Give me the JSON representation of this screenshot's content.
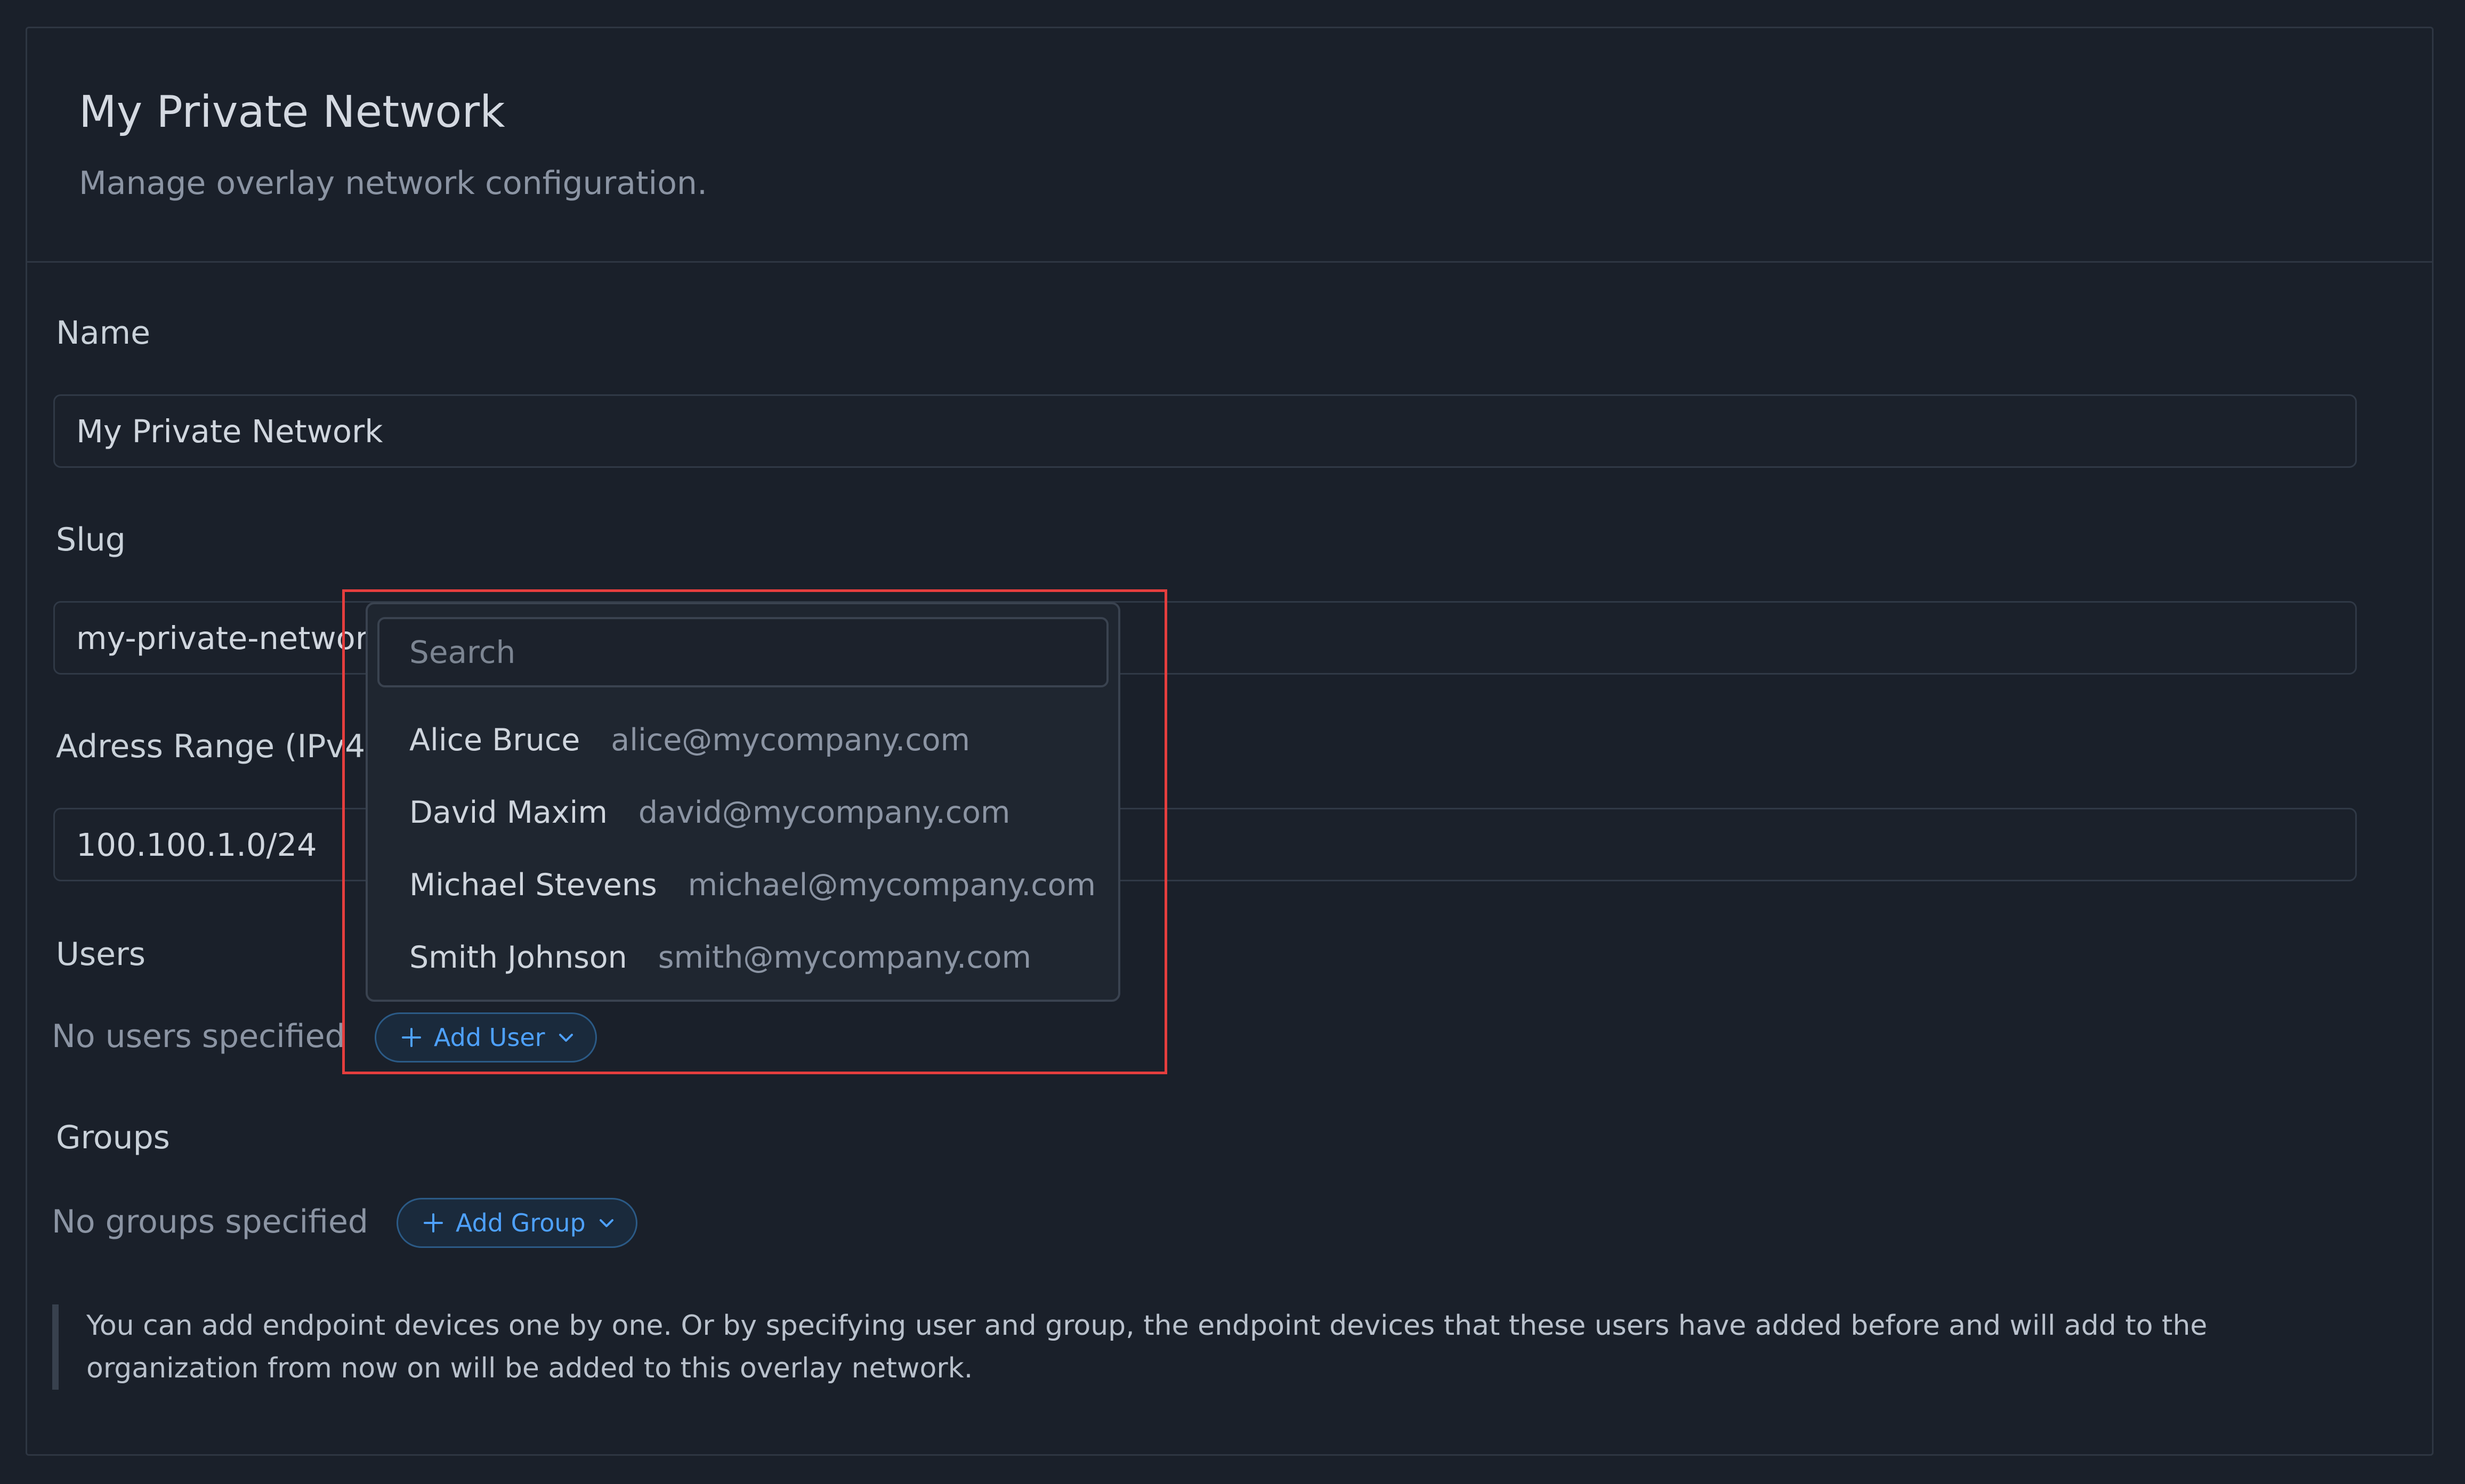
{
  "page": {
    "title": "My Private Network",
    "subtitle": "Manage overlay network configuration."
  },
  "form": {
    "name_label": "Name",
    "name_value": "My Private Network",
    "slug_label": "Slug",
    "slug_value": "my-private-network",
    "range_label": "Adress Range (IPv4)",
    "range_value": "100.100.1.0/24",
    "users_label": "Users",
    "users_empty": "No users specified",
    "add_user_label": "Add User",
    "groups_label": "Groups",
    "groups_empty": "No groups specified",
    "add_group_label": "Add Group",
    "note": "You can add endpoint devices one by one. Or by specifying user and group, the endpoint devices that these users have added before and will add to the organization from now on will be added to this overlay network."
  },
  "dropdown": {
    "search_placeholder": "Search",
    "items": [
      {
        "name": "Alice Bruce",
        "email": "alice@mycompany.com"
      },
      {
        "name": "David Maxim",
        "email": "david@mycompany.com"
      },
      {
        "name": "Michael Stevens",
        "email": "michael@mycompany.com"
      },
      {
        "name": "Smith Johnson",
        "email": "smith@mycompany.com"
      }
    ]
  },
  "colors": {
    "background": "#1a202a",
    "accent": "#4ea1ff",
    "highlight": "#e53e3e"
  },
  "icons": [
    "plus-icon",
    "chevron-down-icon"
  ]
}
